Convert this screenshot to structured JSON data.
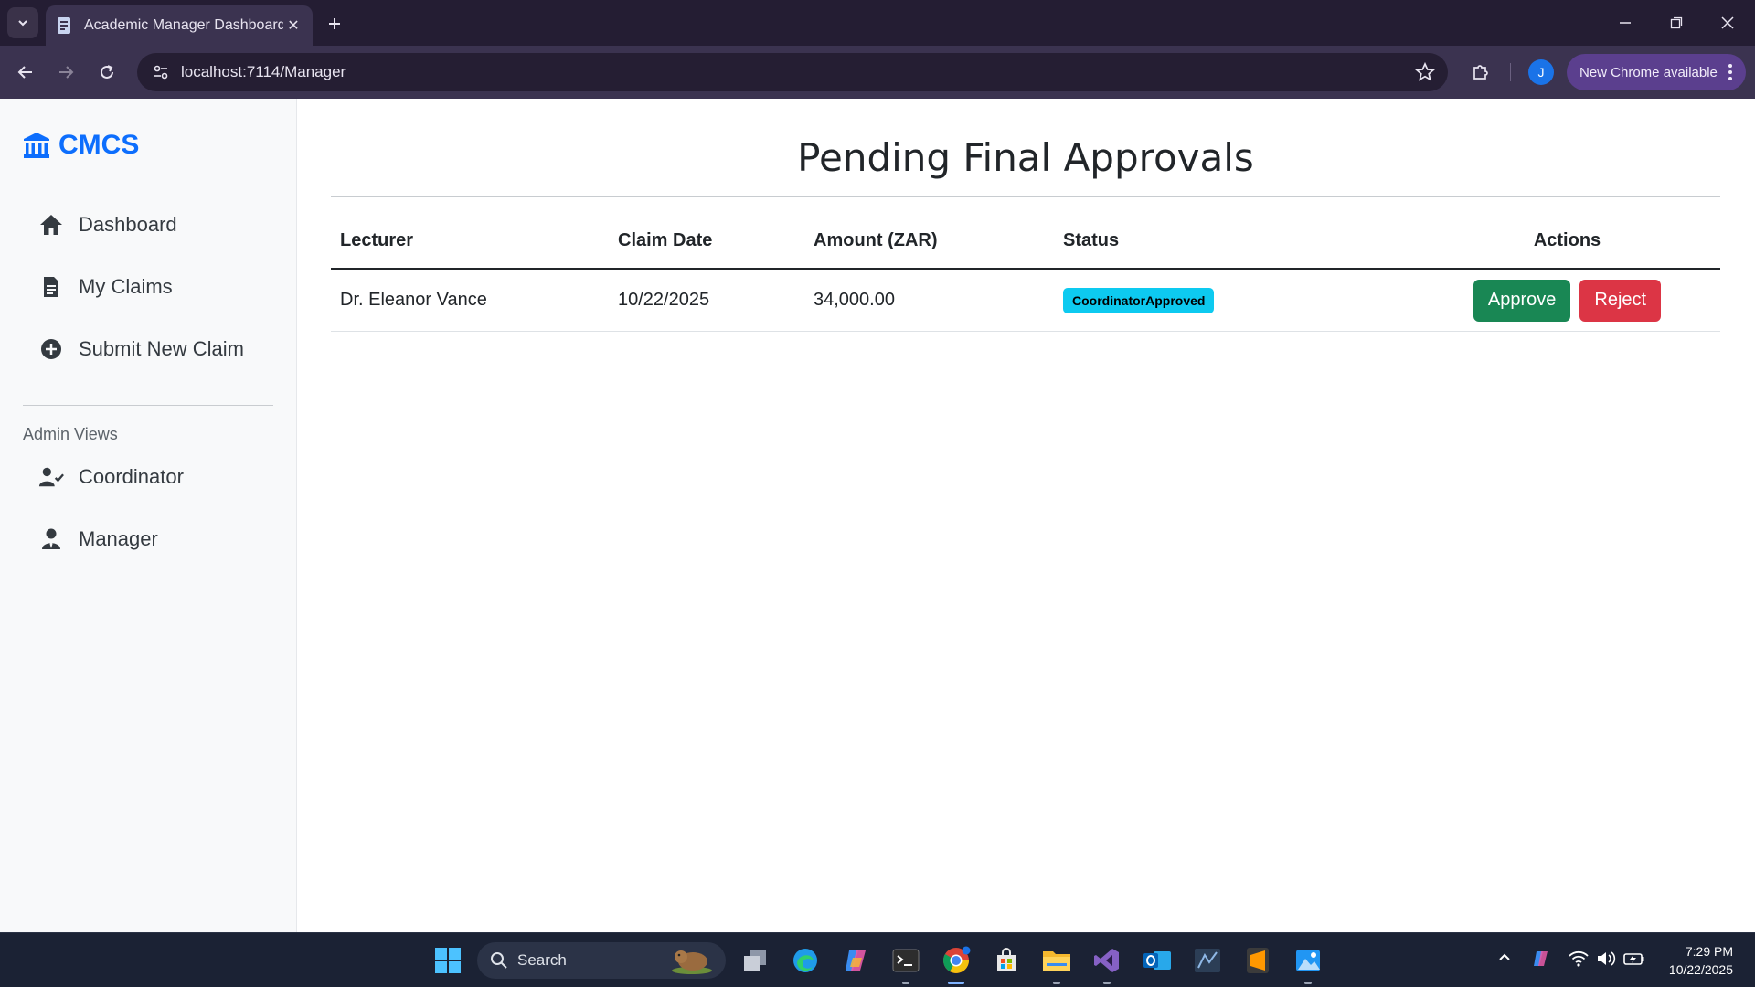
{
  "browser": {
    "tab_title": "Academic Manager Dashboard",
    "url": "localhost:7114/Manager",
    "profile_initial": "J",
    "update_label": "New Chrome available"
  },
  "sidebar": {
    "brand": "CMCS",
    "items": [
      {
        "label": "Dashboard",
        "icon": "home-icon"
      },
      {
        "label": "My Claims",
        "icon": "document-icon"
      },
      {
        "label": "Submit New Claim",
        "icon": "plus-circle-icon"
      }
    ],
    "section_label": "Admin Views",
    "admin_items": [
      {
        "label": "Coordinator",
        "icon": "user-check-icon"
      },
      {
        "label": "Manager",
        "icon": "user-tie-icon"
      }
    ]
  },
  "main": {
    "title": "Pending Final Approvals",
    "table": {
      "headers": [
        "Lecturer",
        "Claim Date",
        "Amount (ZAR)",
        "Status",
        "Actions"
      ],
      "rows": [
        {
          "lecturer": "Dr. Eleanor Vance",
          "claim_date": "10/22/2025",
          "amount": "34,000.00",
          "status": "CoordinatorApproved",
          "approve_label": "Approve",
          "reject_label": "Reject"
        }
      ]
    }
  },
  "taskbar": {
    "search_placeholder": "Search",
    "time": "7:29 PM",
    "date": "10/22/2025"
  },
  "colors": {
    "primary": "#0d6efd",
    "approve": "#198754",
    "reject": "#dc3545",
    "status_badge": "#0dcaf0"
  }
}
